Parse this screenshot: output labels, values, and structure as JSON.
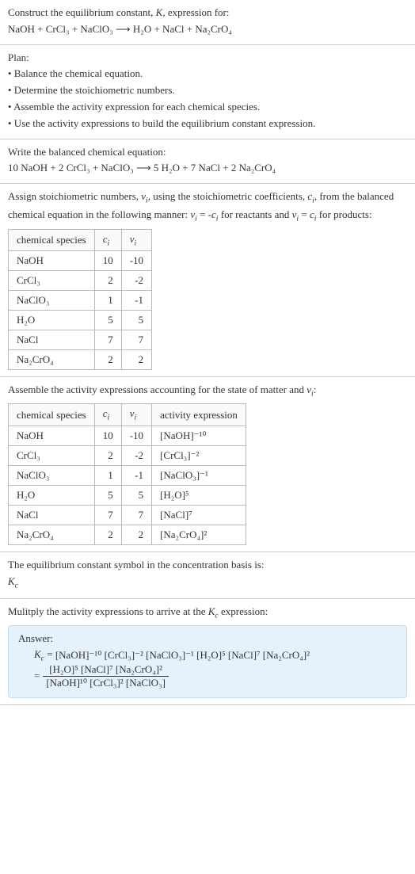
{
  "section1": {
    "intro": "Construct the equilibrium constant, K, expression for:",
    "equation": "NaOH + CrCl₃ + NaClO₃ ⟶ H₂O + NaCl + Na₂CrO₄"
  },
  "section2": {
    "title": "Plan:",
    "items": [
      "• Balance the chemical equation.",
      "• Determine the stoichiometric numbers.",
      "• Assemble the activity expression for each chemical species.",
      "• Use the activity expressions to build the equilibrium constant expression."
    ]
  },
  "section3": {
    "intro": "Write the balanced chemical equation:",
    "equation": "10 NaOH + 2 CrCl₃ + NaClO₃ ⟶ 5 H₂O + 7 NaCl + 2 Na₂CrO₄"
  },
  "section4": {
    "intro_a": "Assign stoichiometric numbers, νᵢ, using the stoichiometric coefficients, cᵢ, from the balanced chemical equation in the following manner: νᵢ = -cᵢ for reactants and νᵢ = cᵢ for products:",
    "headers": {
      "species": "chemical species",
      "ci": "cᵢ",
      "vi": "νᵢ"
    },
    "rows": [
      {
        "species": "NaOH",
        "ci": "10",
        "vi": "-10"
      },
      {
        "species": "CrCl₃",
        "ci": "2",
        "vi": "-2"
      },
      {
        "species": "NaClO₃",
        "ci": "1",
        "vi": "-1"
      },
      {
        "species": "H₂O",
        "ci": "5",
        "vi": "5"
      },
      {
        "species": "NaCl",
        "ci": "7",
        "vi": "7"
      },
      {
        "species": "Na₂CrO₄",
        "ci": "2",
        "vi": "2"
      }
    ]
  },
  "section5": {
    "intro": "Assemble the activity expressions accounting for the state of matter and νᵢ:",
    "headers": {
      "species": "chemical species",
      "ci": "cᵢ",
      "vi": "νᵢ",
      "act": "activity expression"
    },
    "rows": [
      {
        "species": "NaOH",
        "ci": "10",
        "vi": "-10",
        "act": "[NaOH]⁻¹⁰"
      },
      {
        "species": "CrCl₃",
        "ci": "2",
        "vi": "-2",
        "act": "[CrCl₃]⁻²"
      },
      {
        "species": "NaClO₃",
        "ci": "1",
        "vi": "-1",
        "act": "[NaClO₃]⁻¹"
      },
      {
        "species": "H₂O",
        "ci": "5",
        "vi": "5",
        "act": "[H₂O]⁵"
      },
      {
        "species": "NaCl",
        "ci": "7",
        "vi": "7",
        "act": "[NaCl]⁷"
      },
      {
        "species": "Na₂CrO₄",
        "ci": "2",
        "vi": "2",
        "act": "[Na₂CrO₄]²"
      }
    ]
  },
  "section6": {
    "line1": "The equilibrium constant symbol in the concentration basis is:",
    "symbol": "K𝑐"
  },
  "section7": {
    "intro": "Mulitply the activity expressions to arrive at the K𝑐 expression:",
    "answer_label": "Answer:",
    "line1_lhs": "K𝑐 = ",
    "line1_rhs": "[NaOH]⁻¹⁰ [CrCl₃]⁻² [NaClO₃]⁻¹ [H₂O]⁵ [NaCl]⁷ [Na₂CrO₄]²",
    "eq": "= ",
    "frac_num": "[H₂O]⁵ [NaCl]⁷ [Na₂CrO₄]²",
    "frac_den": "[NaOH]¹⁰ [CrCl₃]² [NaClO₃]"
  }
}
